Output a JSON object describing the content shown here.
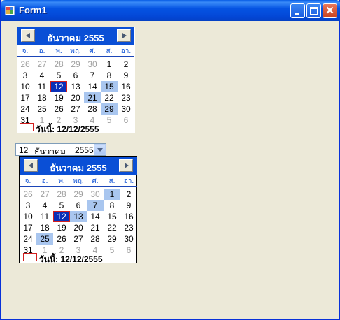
{
  "window": {
    "title": "Form1"
  },
  "cal1": {
    "title": "ธันวาคม 2555",
    "dows": [
      "จ.",
      "อ.",
      "พ.",
      "พฤ.",
      "ศ.",
      "ส.",
      "อา."
    ],
    "days": [
      {
        "t": "26",
        "s": "other"
      },
      {
        "t": "27",
        "s": "other"
      },
      {
        "t": "28",
        "s": "other"
      },
      {
        "t": "29",
        "s": "other"
      },
      {
        "t": "30",
        "s": "other"
      },
      {
        "t": "1",
        "s": ""
      },
      {
        "t": "2",
        "s": ""
      },
      {
        "t": "3",
        "s": ""
      },
      {
        "t": "4",
        "s": ""
      },
      {
        "t": "5",
        "s": ""
      },
      {
        "t": "6",
        "s": ""
      },
      {
        "t": "7",
        "s": ""
      },
      {
        "t": "8",
        "s": ""
      },
      {
        "t": "9",
        "s": ""
      },
      {
        "t": "10",
        "s": ""
      },
      {
        "t": "11",
        "s": ""
      },
      {
        "t": "12",
        "s": "sel"
      },
      {
        "t": "13",
        "s": ""
      },
      {
        "t": "14",
        "s": ""
      },
      {
        "t": "15",
        "s": "bold"
      },
      {
        "t": "16",
        "s": ""
      },
      {
        "t": "17",
        "s": ""
      },
      {
        "t": "18",
        "s": ""
      },
      {
        "t": "19",
        "s": ""
      },
      {
        "t": "20",
        "s": ""
      },
      {
        "t": "21",
        "s": "bold"
      },
      {
        "t": "22",
        "s": ""
      },
      {
        "t": "23",
        "s": ""
      },
      {
        "t": "24",
        "s": ""
      },
      {
        "t": "25",
        "s": ""
      },
      {
        "t": "26",
        "s": ""
      },
      {
        "t": "27",
        "s": ""
      },
      {
        "t": "28",
        "s": ""
      },
      {
        "t": "29",
        "s": "bold"
      },
      {
        "t": "30",
        "s": ""
      },
      {
        "t": "31",
        "s": ""
      },
      {
        "t": "1",
        "s": "other"
      },
      {
        "t": "2",
        "s": "other"
      },
      {
        "t": "3",
        "s": "other"
      },
      {
        "t": "4",
        "s": "other"
      },
      {
        "t": "5",
        "s": "other"
      },
      {
        "t": "6",
        "s": "other"
      }
    ],
    "today": "วันนี้: 12/12/2555"
  },
  "picker": {
    "day": "12",
    "month": "ธันวาคม",
    "year": "2555"
  },
  "cal2": {
    "title": "ธันวาคม 2555",
    "dows": [
      "จ.",
      "อ.",
      "พ.",
      "พฤ.",
      "ศ.",
      "ส.",
      "อา."
    ],
    "days": [
      {
        "t": "26",
        "s": "other"
      },
      {
        "t": "27",
        "s": "other"
      },
      {
        "t": "28",
        "s": "other"
      },
      {
        "t": "29",
        "s": "other"
      },
      {
        "t": "30",
        "s": "other"
      },
      {
        "t": "1",
        "s": "bold"
      },
      {
        "t": "2",
        "s": ""
      },
      {
        "t": "3",
        "s": ""
      },
      {
        "t": "4",
        "s": ""
      },
      {
        "t": "5",
        "s": ""
      },
      {
        "t": "6",
        "s": ""
      },
      {
        "t": "7",
        "s": "bold"
      },
      {
        "t": "8",
        "s": ""
      },
      {
        "t": "9",
        "s": ""
      },
      {
        "t": "10",
        "s": ""
      },
      {
        "t": "11",
        "s": ""
      },
      {
        "t": "12",
        "s": "sel"
      },
      {
        "t": "13",
        "s": "bold"
      },
      {
        "t": "14",
        "s": ""
      },
      {
        "t": "15",
        "s": ""
      },
      {
        "t": "16",
        "s": ""
      },
      {
        "t": "17",
        "s": ""
      },
      {
        "t": "18",
        "s": ""
      },
      {
        "t": "19",
        "s": ""
      },
      {
        "t": "20",
        "s": ""
      },
      {
        "t": "21",
        "s": ""
      },
      {
        "t": "22",
        "s": ""
      },
      {
        "t": "23",
        "s": ""
      },
      {
        "t": "24",
        "s": ""
      },
      {
        "t": "25",
        "s": "bold"
      },
      {
        "t": "26",
        "s": ""
      },
      {
        "t": "27",
        "s": ""
      },
      {
        "t": "28",
        "s": ""
      },
      {
        "t": "29",
        "s": ""
      },
      {
        "t": "30",
        "s": ""
      },
      {
        "t": "31",
        "s": ""
      },
      {
        "t": "1",
        "s": "other"
      },
      {
        "t": "2",
        "s": "other"
      },
      {
        "t": "3",
        "s": "other"
      },
      {
        "t": "4",
        "s": "other"
      },
      {
        "t": "5",
        "s": "other"
      },
      {
        "t": "6",
        "s": "other"
      }
    ],
    "today": "วันนี้: 12/12/2555"
  }
}
